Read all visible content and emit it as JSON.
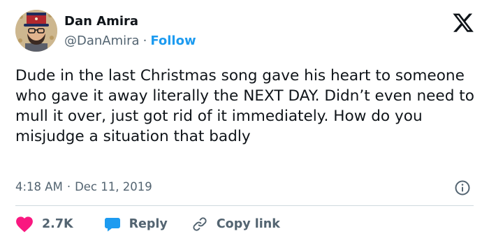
{
  "author": {
    "name": "Dan Amira",
    "handle": "@DanAmira",
    "separator": "·",
    "follow_label": "Follow"
  },
  "tweet": {
    "text": "Dude in the last Christmas song gave his heart to someone who gave it away literally the NEXT DAY. Didn’t even need to mull it over, just got rid of it immediately. How do you misjudge a situation that badly",
    "time": "4:18 AM",
    "separator": "·",
    "date": "Dec 11, 2019"
  },
  "actions": {
    "likes_count": "2.7K",
    "reply_label": "Reply",
    "copy_link_label": "Copy link"
  },
  "icons": {
    "logo": "x-logo-icon",
    "info": "info-icon",
    "like": "heart-icon",
    "reply": "speech-bubble-icon",
    "copy": "link-icon"
  },
  "colors": {
    "text": "#0f1419",
    "secondary": "#536471",
    "accent": "#1d9bf0",
    "like": "#f91880",
    "divider": "#cfd9de"
  }
}
